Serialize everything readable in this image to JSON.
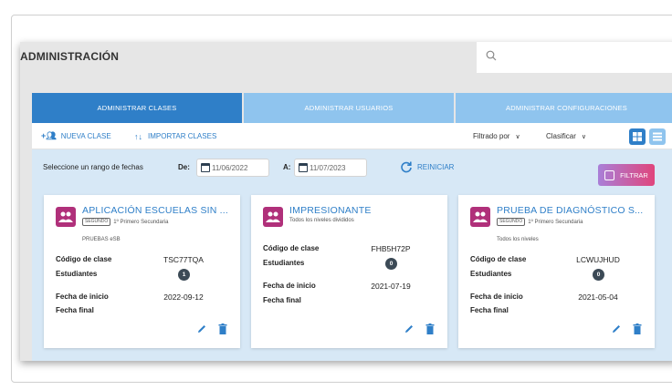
{
  "header": {
    "title": "ADMINISTRACIÓN",
    "search_placeholder": ""
  },
  "tabs": [
    {
      "label": "ADMINISTRAR CLASES",
      "active": true
    },
    {
      "label": "ADMINISTRAR USUARIOS",
      "active": false
    },
    {
      "label": "ADMINISTRAR CONFIGURACIONES",
      "active": false
    }
  ],
  "toolbar": {
    "new_class": "NUEVA CLASE",
    "import_classes": "IMPORTAR CLASES",
    "filter_by": "Filtrado por",
    "sort": "Clasificar"
  },
  "date_filter": {
    "prompt": "Seleccione un rango de fechas",
    "from_label": "De:",
    "from_value": "11/06/2022",
    "to_label": "A:",
    "to_value": "11/07/2023",
    "reset": "REINICIAR",
    "filter": "FILTRAR"
  },
  "labels": {
    "code": "Código de clase",
    "students": "Estudiantes",
    "start": "Fecha de inicio",
    "end": "Fecha final"
  },
  "cards": [
    {
      "title": "APLICACIÓN ESCUELAS SIN ...",
      "grade_tag": "SEGUNDO",
      "level": "1º Primero Secundaria",
      "extra": "PRUEBAS eSB",
      "code": "TSC77TQA",
      "students": "1",
      "start": "2022-09-12",
      "end": ""
    },
    {
      "title": "IMPRESIONANTE",
      "grade_tag": "",
      "level": "Todos los niveles divididos",
      "extra": "",
      "code": "FHB5H72P",
      "students": "0",
      "start": "2021-07-19",
      "end": ""
    },
    {
      "title": "PRUEBA DE DIAGNÓSTICO S...",
      "grade_tag": "SEGUNDO",
      "level": "1º Primero Secundaria",
      "extra": "Todos los niveles",
      "code": "LCWUJHUD",
      "students": "0",
      "start": "2021-05-04",
      "end": ""
    }
  ],
  "colors": {
    "primary": "#2f7fc8",
    "tab_inactive": "#8fc4ee",
    "content_bg": "#d7e8f6",
    "avatar": "#b0307a"
  }
}
